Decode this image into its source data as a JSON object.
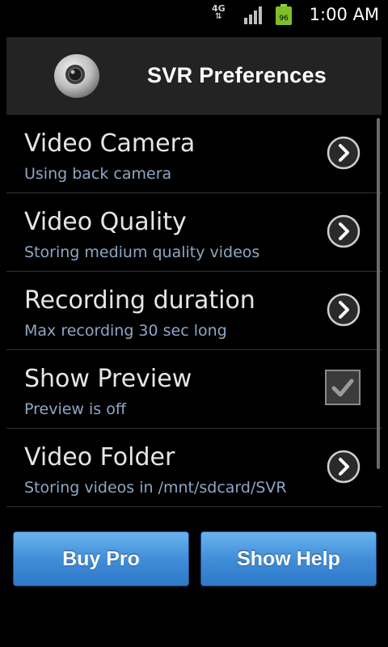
{
  "status_bar": {
    "network": "4G",
    "battery_level": "96",
    "time": "1:00 AM",
    "signal_icon": "signal-bars-icon",
    "battery_icon": "battery-icon"
  },
  "header": {
    "title": "SVR Preferences",
    "logo_icon": "camera-lens-icon"
  },
  "preferences": [
    {
      "title": "Video Camera",
      "summary": "Using back camera",
      "control": "chevron"
    },
    {
      "title": "Video Quality",
      "summary": "Storing medium quality videos",
      "control": "chevron"
    },
    {
      "title": "Recording duration",
      "summary": "Max recording 30 sec long",
      "control": "chevron"
    },
    {
      "title": "Show Preview",
      "summary": "Preview is off",
      "control": "checkbox",
      "checked": true
    },
    {
      "title": "Video Folder",
      "summary": "Storing videos in /mnt/sdcard/SVR",
      "control": "chevron"
    }
  ],
  "buttons": {
    "buy_pro": "Buy Pro",
    "show_help": "Show Help"
  },
  "colors": {
    "background": "#000000",
    "header_bg": "#232323",
    "summary_text": "#8ea7c4",
    "button_blue": "#3e8bd6"
  }
}
